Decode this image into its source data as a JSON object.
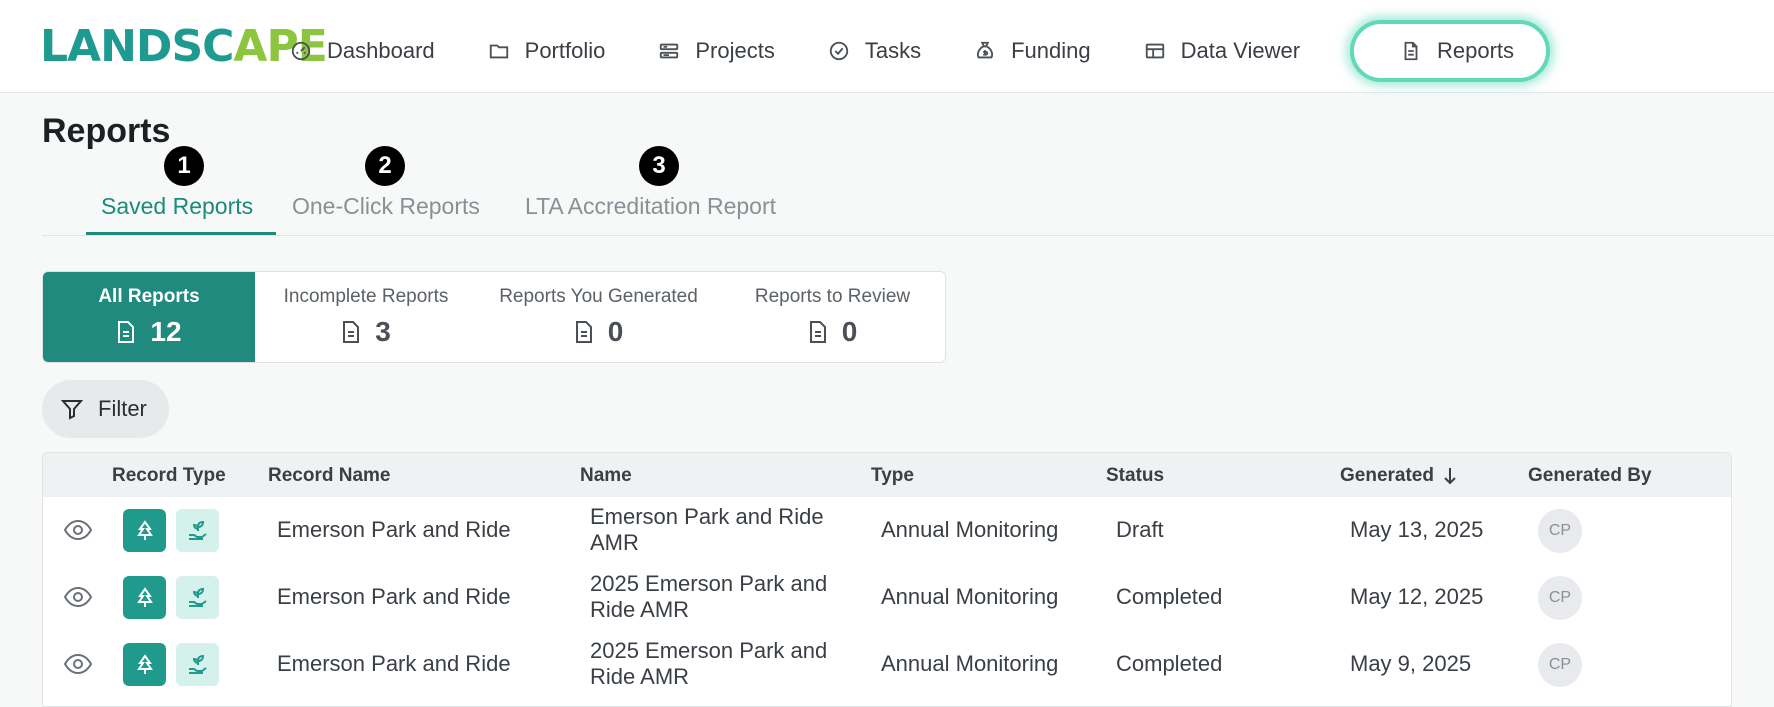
{
  "logo": {
    "part1": "LANDSC",
    "part2": "PE",
    "pin": "A"
  },
  "nav": [
    {
      "label": "Dashboard",
      "icon": "gauge-icon"
    },
    {
      "label": "Portfolio",
      "icon": "folder-icon"
    },
    {
      "label": "Projects",
      "icon": "projects-icon"
    },
    {
      "label": "Tasks",
      "icon": "check-circle-icon"
    },
    {
      "label": "Funding",
      "icon": "money-bag-icon"
    },
    {
      "label": "Data Viewer",
      "icon": "table-icon"
    },
    {
      "label": "Reports",
      "icon": "document-icon"
    }
  ],
  "page": {
    "title": "Reports"
  },
  "badges": [
    "1",
    "2",
    "3"
  ],
  "tabs": [
    "Saved Reports",
    "One-Click Reports",
    "LTA Accreditation Report"
  ],
  "cards": [
    {
      "label": "All Reports",
      "count": "12"
    },
    {
      "label": "Incomplete Reports",
      "count": "3"
    },
    {
      "label": "Reports You Generated",
      "count": "0"
    },
    {
      "label": "Reports to Review",
      "count": "0"
    }
  ],
  "filter": {
    "label": "Filter"
  },
  "table": {
    "headers": [
      "Record Type",
      "Record Name",
      "Name",
      "Type",
      "Status",
      "Generated",
      "Generated By"
    ],
    "rows": [
      {
        "record_name": "Emerson Park and Ride",
        "name_line1": "Emerson Park and Ride",
        "name_line2": "AMR",
        "type": "Annual Monitoring",
        "status": "Draft",
        "generated": "May 13, 2025",
        "by": "CP"
      },
      {
        "record_name": "Emerson Park and Ride",
        "name_line1": "2025 Emerson Park and",
        "name_line2": "Ride AMR",
        "type": "Annual Monitoring",
        "status": "Completed",
        "generated": "May 12, 2025",
        "by": "CP"
      },
      {
        "record_name": "Emerson Park and Ride",
        "name_line1": "2025 Emerson Park and",
        "name_line2": "Ride AMR",
        "type": "Annual Monitoring",
        "status": "Completed",
        "generated": "May 9, 2025",
        "by": "CP"
      }
    ]
  },
  "colors": {
    "accent": "#1f8a7d",
    "highlight": "#5fd9b7",
    "logo_teal": "#1f9a90",
    "logo_green": "#8cc63f"
  }
}
